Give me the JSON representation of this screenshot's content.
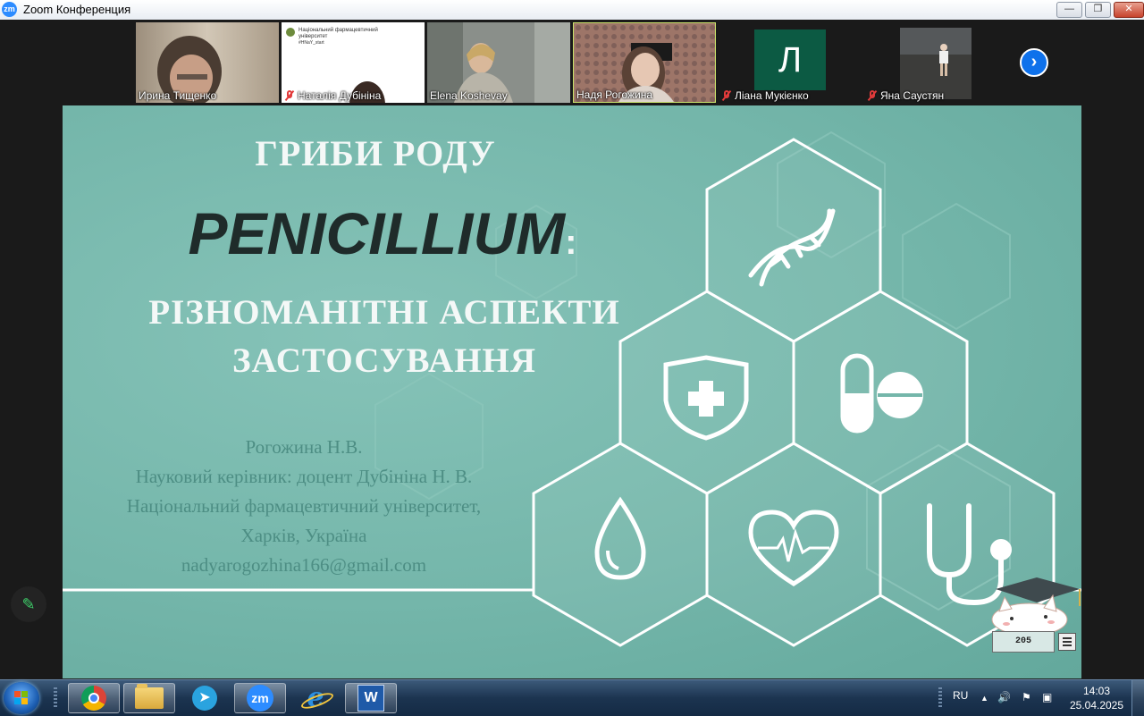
{
  "window": {
    "title": "Zoom Конференция",
    "app_icon_text": "zm",
    "minimize_glyph": "—",
    "maximize_glyph": "❐",
    "close_glyph": "✕"
  },
  "participants": [
    {
      "name": "Ирина Тищенко",
      "muted": false
    },
    {
      "name": "Наталія Дубініна",
      "muted": true
    },
    {
      "name": "Elena Koshevay",
      "muted": false
    },
    {
      "name": "Надя Рогожина",
      "muted": false,
      "active_speaker": true
    },
    {
      "name": "Ліана Мукієнко",
      "muted": true,
      "avatar_letter": "Л"
    },
    {
      "name": "Яна Саустян",
      "muted": true
    }
  ],
  "shared_doc": {
    "line1": "Національний фармацевтичний університет",
    "line2": "#HNaY_start"
  },
  "next_page_glyph": "›",
  "slide": {
    "title_line1": "ГРИБИ РОДУ",
    "title_line2": "PENICILLIUM",
    "title_colon": ":",
    "title_line3": "РІЗНОМАНІТНІ АСПЕКТИ",
    "title_line4": "ЗАСТОСУВАННЯ",
    "author": "Рогожина Н.В.",
    "supervisor": "Науковий керівник: доцент Дубініна Н. В.",
    "university": "Національний фармацевтичний університет,",
    "city": "Харків, Україна",
    "email": "nadyarogozhina166@gmail.com",
    "icons": [
      "dna-icon",
      "shield-cross-icon",
      "pills-icon",
      "drop-icon",
      "heartbeat-icon",
      "stethoscope-icon"
    ],
    "badge_text": "205"
  },
  "annotate_glyph": "✎",
  "taskbar": {
    "apps": [
      "chrome",
      "explorer",
      "telegram",
      "zoom",
      "internet-explorer",
      "word"
    ],
    "zoom_label": "zm",
    "telegram_glyph": "➤",
    "ie_glyph": "e",
    "word_glyph": "W",
    "language": "RU",
    "tray_up_glyph": "▲",
    "volume_glyph": "🔊",
    "flag_glyph": "⚑",
    "network_glyph": "▣",
    "time": "14:03",
    "date": "25.04.2025"
  },
  "colors": {
    "slide_bg": "#74b6aa",
    "zoom_blue": "#2d8cff",
    "mute_red": "#e23b3b",
    "avatar_green": "#0c5a43",
    "active_speaker_border": "#c8e26a"
  }
}
